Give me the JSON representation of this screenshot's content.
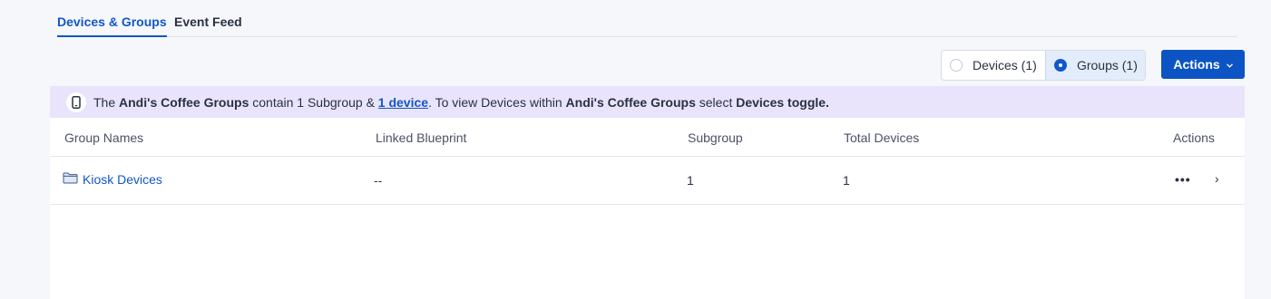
{
  "tabs": [
    {
      "label": "Devices & Groups",
      "active": true
    },
    {
      "label": "Event Feed",
      "active": false
    }
  ],
  "toggle": {
    "devices_label": "Devices (1)",
    "groups_label": "Groups (1)",
    "selected": "groups"
  },
  "actions_button": {
    "label": "Actions",
    "icon": "chevron-down-icon"
  },
  "banner": {
    "icon": "mobile-device-icon",
    "part1": "The ",
    "group_name": "Andi's Coffee Groups",
    "part2": " contain 1 Subgroup & ",
    "link": "1 device",
    "part3": ". To view Devices within ",
    "group_name_2": "Andi's Coffee Groups",
    "part4": " select ",
    "toggle_hint": "Devices toggle."
  },
  "table": {
    "headers": {
      "group_names": "Group Names",
      "linked_blueprint": "Linked Blueprint",
      "subgroup": "Subgroup",
      "total_devices": "Total Devices",
      "actions": "Actions"
    },
    "rows": [
      {
        "icon": "folder-icon",
        "name": "Kiosk Devices",
        "linked_blueprint": "--",
        "subgroup": "1",
        "total_devices": "1",
        "more": "•••",
        "open": "›"
      }
    ]
  },
  "colors": {
    "accent": "#1257c8",
    "primary_button": "#0c54c4",
    "banner_bg": "#e9e4fb",
    "page_bg": "#f5f7fb"
  }
}
